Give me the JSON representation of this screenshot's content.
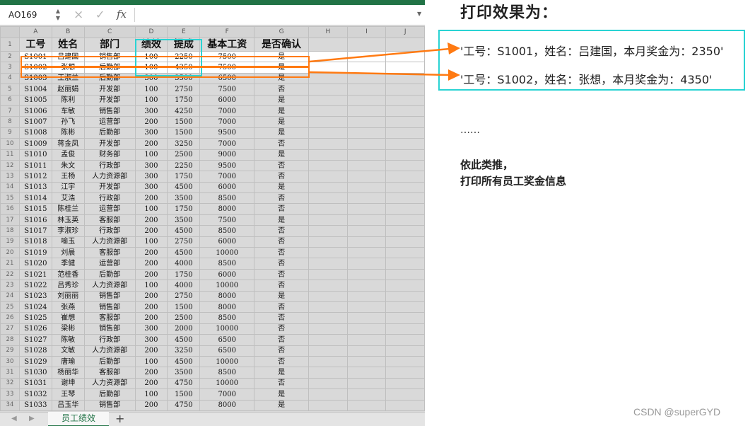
{
  "namebox": "AO169",
  "formula_icons": {
    "cancel": "×",
    "confirm": "✓",
    "fx": "fx"
  },
  "columns": [
    "A",
    "B",
    "C",
    "D",
    "E",
    "F",
    "G",
    "H",
    "I",
    "J"
  ],
  "header_row": [
    "工号",
    "姓名",
    "部门",
    "绩效",
    "提成",
    "基本工资",
    "是否确认"
  ],
  "rows": [
    [
      "S1001",
      "吕建国",
      "销售部",
      "100",
      "2250",
      "7500",
      "是"
    ],
    [
      "S1002",
      "张想",
      "后勤部",
      "100",
      "4350",
      "7500",
      "是"
    ],
    [
      "S1003",
      "王淑兰",
      "后勤部",
      "300",
      "3500",
      "6500",
      "是"
    ],
    [
      "S1004",
      "赵丽娟",
      "开发部",
      "100",
      "2750",
      "7500",
      "否"
    ],
    [
      "S1005",
      "陈利",
      "开发部",
      "100",
      "1750",
      "6000",
      "是"
    ],
    [
      "S1006",
      "车敏",
      "销售部",
      "300",
      "4250",
      "7000",
      "是"
    ],
    [
      "S1007",
      "孙飞",
      "运营部",
      "200",
      "1500",
      "7000",
      "是"
    ],
    [
      "S1008",
      "陈彬",
      "后勤部",
      "300",
      "1500",
      "9500",
      "是"
    ],
    [
      "S1009",
      "蒋金凤",
      "开发部",
      "200",
      "3250",
      "7000",
      "否"
    ],
    [
      "S1010",
      "孟俊",
      "财务部",
      "100",
      "2500",
      "9000",
      "是"
    ],
    [
      "S1011",
      "朱文",
      "行政部",
      "300",
      "2250",
      "9500",
      "否"
    ],
    [
      "S1012",
      "王杨",
      "人力资源部",
      "300",
      "1750",
      "7000",
      "否"
    ],
    [
      "S1013",
      "江宇",
      "开发部",
      "300",
      "4500",
      "6000",
      "是"
    ],
    [
      "S1014",
      "艾浩",
      "行政部",
      "200",
      "3500",
      "8500",
      "否"
    ],
    [
      "S1015",
      "陈桂兰",
      "运营部",
      "100",
      "1750",
      "8000",
      "否"
    ],
    [
      "S1016",
      "林玉英",
      "客服部",
      "200",
      "3500",
      "7500",
      "是"
    ],
    [
      "S1017",
      "李淑珍",
      "行政部",
      "200",
      "4500",
      "8500",
      "否"
    ],
    [
      "S1018",
      "喻玉",
      "人力资源部",
      "100",
      "2750",
      "6000",
      "否"
    ],
    [
      "S1019",
      "刘晨",
      "客服部",
      "200",
      "4500",
      "10000",
      "否"
    ],
    [
      "S1020",
      "季健",
      "运营部",
      "200",
      "4000",
      "8500",
      "否"
    ],
    [
      "S1021",
      "范桂香",
      "后勤部",
      "200",
      "1750",
      "6000",
      "否"
    ],
    [
      "S1022",
      "吕秀珍",
      "人力资源部",
      "100",
      "4000",
      "10000",
      "否"
    ],
    [
      "S1023",
      "刘丽丽",
      "销售部",
      "200",
      "2750",
      "8000",
      "是"
    ],
    [
      "S1024",
      "张燕",
      "销售部",
      "200",
      "1500",
      "8000",
      "否"
    ],
    [
      "S1025",
      "崔想",
      "客服部",
      "200",
      "2500",
      "8500",
      "否"
    ],
    [
      "S1026",
      "梁彬",
      "销售部",
      "300",
      "2000",
      "10000",
      "否"
    ],
    [
      "S1027",
      "陈敏",
      "行政部",
      "300",
      "4500",
      "6500",
      "否"
    ],
    [
      "S1028",
      "文敏",
      "人力资源部",
      "200",
      "3250",
      "6500",
      "否"
    ],
    [
      "S1029",
      "唐瑜",
      "后勤部",
      "100",
      "4500",
      "10000",
      "否"
    ],
    [
      "S1030",
      "杨丽华",
      "客服部",
      "200",
      "3500",
      "8500",
      "是"
    ],
    [
      "S1031",
      "谢坤",
      "人力资源部",
      "200",
      "4750",
      "10000",
      "否"
    ],
    [
      "S1032",
      "王琴",
      "后勤部",
      "100",
      "1500",
      "7000",
      "是"
    ],
    [
      "S1033",
      "吕玉华",
      "销售部",
      "200",
      "4750",
      "8000",
      "是"
    ]
  ],
  "sheet_tab": "员工绩效",
  "add_sheet": "+",
  "result_title": "打印效果为：",
  "result_lines": [
    "'工号：S1001，姓名：吕建国，本月奖金为：2350'",
    "'工号：S1002，姓名：张想，本月奖金为：4350'"
  ],
  "ellipsis": "……",
  "note_lines": [
    "依此类推，",
    "打印所有员工奖金信息"
  ],
  "watermark": "CSDN @superGYD",
  "colors": {
    "cyan": "#2ad3d3",
    "orange": "#ff7a12",
    "excel_green": "#217346"
  }
}
